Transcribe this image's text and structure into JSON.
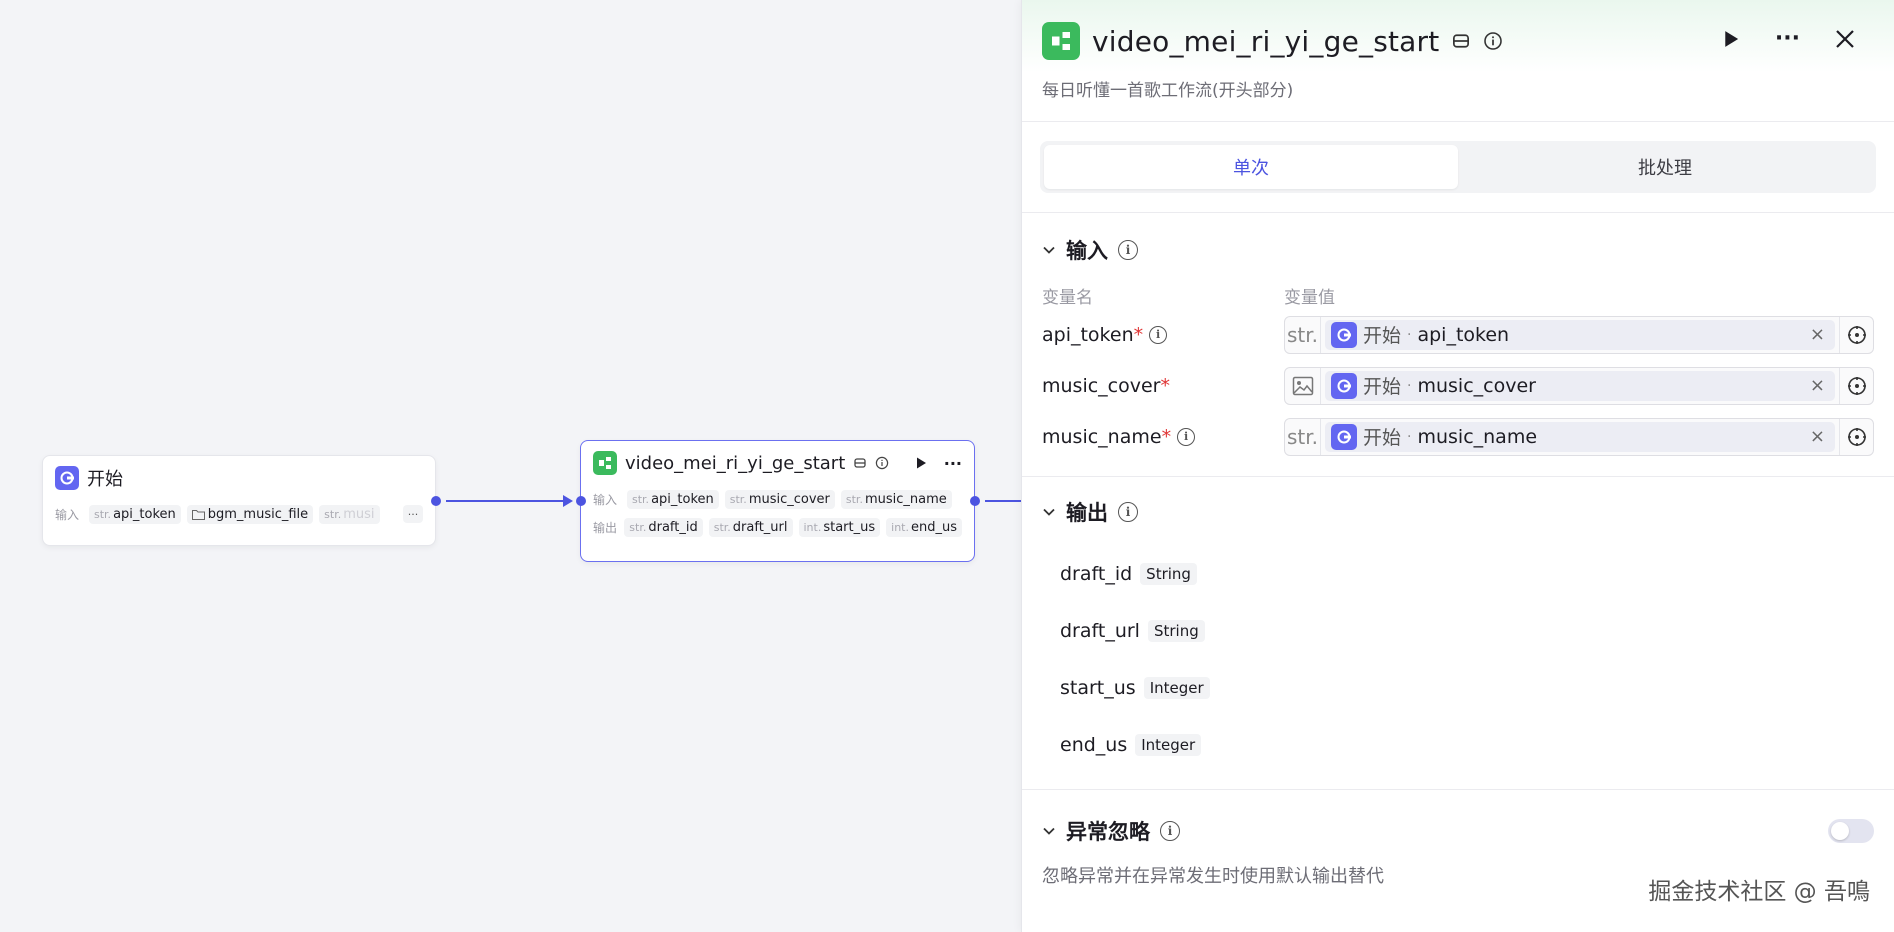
{
  "canvas": {
    "start_node": {
      "title": "开始",
      "inputs_label": "输入",
      "inputs": [
        {
          "type": "str.",
          "name": "api_token"
        },
        {
          "type": "",
          "name": "bgm_music_file"
        },
        {
          "type": "str.",
          "name": "musi"
        }
      ],
      "more": "···"
    },
    "workflow_node": {
      "title": "video_mei_ri_yi_ge_start",
      "inputs_label": "输入",
      "inputs": [
        {
          "type": "str.",
          "name": "api_token"
        },
        {
          "type": "str.",
          "name": "music_cover"
        },
        {
          "type": "str.",
          "name": "music_name"
        }
      ],
      "outputs_label": "输出",
      "outputs": [
        {
          "type": "str.",
          "name": "draft_id"
        },
        {
          "type": "str.",
          "name": "draft_url"
        },
        {
          "type": "int.",
          "name": "start_us"
        },
        {
          "type": "int.",
          "name": "end_us"
        }
      ],
      "more": "···"
    }
  },
  "panel": {
    "title": "video_mei_ri_yi_ge_start",
    "description": "每日听懂一首歌工作流(开头部分)",
    "more": "···",
    "tabs": [
      {
        "label": "单次",
        "active": true
      },
      {
        "label": "批处理",
        "active": false
      }
    ],
    "input_section": {
      "title": "输入",
      "col_name": "变量名",
      "col_value": "变量值",
      "rows": [
        {
          "name": "api_token",
          "required": "*",
          "type_label": "str.",
          "ref_node": "开始",
          "ref_var": "api_token",
          "x": "×"
        },
        {
          "name": "music_cover",
          "required": "*",
          "type_label": "",
          "ref_node": "开始",
          "ref_var": "music_cover",
          "x": "×"
        },
        {
          "name": "music_name",
          "required": "*",
          "type_label": "str.",
          "ref_node": "开始",
          "ref_var": "music_name",
          "x": "×"
        }
      ]
    },
    "output_section": {
      "title": "输出",
      "rows": [
        {
          "name": "draft_id",
          "type": "String"
        },
        {
          "name": "draft_url",
          "type": "String"
        },
        {
          "name": "start_us",
          "type": "Integer"
        },
        {
          "name": "end_us",
          "type": "Integer"
        }
      ]
    },
    "exception_section": {
      "title": "异常忽略",
      "description": "忽略异常并在异常发生时使用默认输出替代",
      "toggle_on": false
    }
  },
  "watermark": "掘金技术社区 @ 吾鳴",
  "colors": {
    "accent": "#4c54e0",
    "start_icon": "#6366f1",
    "workflow_icon": "#3bba5d",
    "required": "#e03535"
  }
}
